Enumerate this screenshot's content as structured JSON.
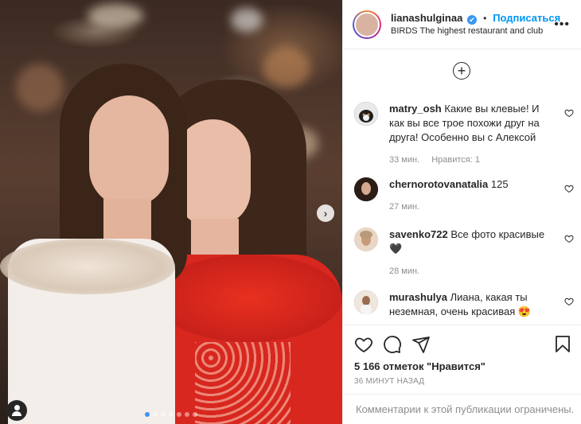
{
  "post": {
    "author": "lianashulginaa",
    "verified_badge": "✔",
    "separator": "•",
    "follow_label": "Подписаться",
    "location": "BIRDS The highest restaurant and club",
    "more_label": "•••",
    "add_label": "+",
    "next_label": "›",
    "carousel": {
      "count": 7,
      "active_index": 0
    },
    "likes_text": "5 166 отметок \"Нравится\"",
    "time_ago": "36 МИНУТ НАЗАД",
    "comments_restricted": "Комментарии к этой публикации ограничены."
  },
  "comments": [
    {
      "user": "matry_osh",
      "text": "Какие вы клевые! И как вы все трое похожи друг на друга! Особенно вы с Алексой",
      "time": "33 мин.",
      "likes": "Нравится: 1",
      "avatar_color": "#1a1a1a"
    },
    {
      "user": "chernorotovanatalia",
      "text": "125",
      "time": "27 мин.",
      "likes": "",
      "avatar_color": "#3a2a22"
    },
    {
      "user": "savenko722",
      "text": "Все фото красивые 🖤",
      "time": "28 мин.",
      "likes": "",
      "avatar_color": "#d4b9a0"
    },
    {
      "user": "murashulya",
      "text": "Лиана, какая ты неземная, очень красивая 😍",
      "time": "",
      "likes": "",
      "avatar_color": "#7a5d4a"
    }
  ],
  "icons": [
    "heart-icon",
    "comment-icon",
    "share-icon",
    "bookmark-icon",
    "user-tag-icon",
    "plus-icon",
    "more-icon",
    "chevron-right-icon",
    "verified-icon"
  ],
  "colors": {
    "link_blue": "#0095f6",
    "carousel_active": "#3897f0",
    "muted": "#8e8e8e"
  }
}
